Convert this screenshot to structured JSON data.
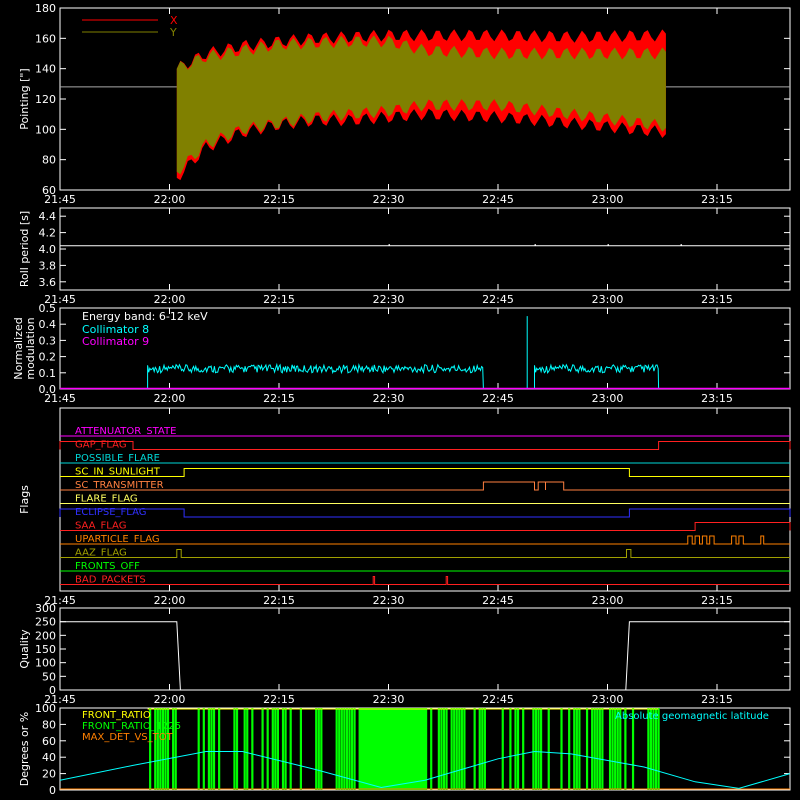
{
  "chart_data": [
    {
      "type": "line",
      "panel": "pointing",
      "ylabel": "Pointing [\"]",
      "xlim": [
        "21:45",
        "23:25"
      ],
      "ylim": [
        60,
        180
      ],
      "yticks": [
        60,
        80,
        100,
        120,
        140,
        160,
        180
      ],
      "xticks": [
        "21:45",
        "22:00",
        "22:15",
        "22:30",
        "22:45",
        "23:00",
        "23:15"
      ],
      "reference_line": 128,
      "data_start": "22:01",
      "data_end": "23:08",
      "legend": [
        {
          "name": "X",
          "color": "#ff0000"
        },
        {
          "name": "Y",
          "color": "#808000"
        }
      ],
      "series": [
        {
          "name": "X",
          "color": "#ff0000",
          "upper": [
            [
              "22:01",
              140
            ],
            [
              "22:05",
              150
            ],
            [
              "22:10",
              155
            ],
            [
              "22:15",
              158
            ],
            [
              "22:20",
              160
            ],
            [
              "22:25",
              161
            ],
            [
              "22:30",
              162
            ],
            [
              "22:35",
              162
            ],
            [
              "22:45",
              162
            ],
            [
              "22:55",
              161
            ],
            [
              "23:08",
              162
            ]
          ],
          "lower": [
            [
              "22:01",
              68
            ],
            [
              "22:05",
              88
            ],
            [
              "22:10",
              98
            ],
            [
              "22:15",
              103
            ],
            [
              "22:20",
              106
            ],
            [
              "22:25",
              106
            ],
            [
              "22:30",
              108
            ],
            [
              "22:35",
              110
            ],
            [
              "22:45",
              108
            ],
            [
              "22:55",
              104
            ],
            [
              "23:08",
              98
            ]
          ]
        },
        {
          "name": "Y",
          "color": "#808000",
          "upper": [
            [
              "22:01",
              140
            ],
            [
              "22:05",
              148
            ],
            [
              "22:10",
              152
            ],
            [
              "22:15",
              156
            ],
            [
              "22:20",
              157
            ],
            [
              "22:25",
              158
            ],
            [
              "22:30",
              158
            ],
            [
              "22:35",
              152
            ],
            [
              "22:45",
              150
            ],
            [
              "22:55",
              150
            ],
            [
              "23:08",
              150
            ]
          ],
          "lower": [
            [
              "22:01",
              72
            ],
            [
              "22:05",
              90
            ],
            [
              "22:10",
              100
            ],
            [
              "22:15",
              104
            ],
            [
              "22:20",
              108
            ],
            [
              "22:25",
              110
            ],
            [
              "22:30",
              112
            ],
            [
              "22:35",
              116
            ],
            [
              "22:45",
              116
            ],
            [
              "22:55",
              110
            ],
            [
              "23:08",
              102
            ]
          ]
        }
      ]
    },
    {
      "type": "line",
      "panel": "roll",
      "ylabel": "Roll period [s]",
      "ylim": [
        3.5,
        4.5
      ],
      "yticks": [
        3.6,
        3.8,
        4.0,
        4.2,
        4.4
      ],
      "xticks": [
        "21:45",
        "22:00",
        "22:15",
        "22:30",
        "22:45",
        "23:00",
        "23:15"
      ],
      "series": [
        {
          "name": "Roll period",
          "color": "#ffffff",
          "value": 4.04
        }
      ]
    },
    {
      "type": "line",
      "panel": "modulation",
      "ylabel": [
        "Normalized",
        "modulation"
      ],
      "ylim": [
        0.0,
        0.5
      ],
      "yticks": [
        0.0,
        0.1,
        0.2,
        0.3,
        0.4,
        0.5
      ],
      "xticks": [
        "21:45",
        "22:00",
        "22:15",
        "22:30",
        "22:45",
        "23:00",
        "23:15"
      ],
      "legend_title": "Energy band: 6-12 keV",
      "series": [
        {
          "name": "Collimator 8",
          "color": "#00ffff",
          "segments": [
            [
              "21:57",
              "22:43"
            ],
            [
              "22:50",
              "23:07"
            ]
          ],
          "level": 0.12,
          "spike": [
            "22:49",
            0.45
          ]
        },
        {
          "name": "Collimator 9",
          "color": "#ff00ff",
          "value": 0.0
        }
      ]
    },
    {
      "type": "line",
      "panel": "flags",
      "ylabel": "Flags",
      "xticks": [
        "21:45",
        "22:00",
        "22:15",
        "22:30",
        "22:45",
        "23:00",
        "23:15"
      ],
      "flags": [
        {
          "name": "ATTENUATOR_STATE",
          "color": "#ff00ff",
          "on": []
        },
        {
          "name": "GAP_FLAG",
          "color": "#ff2020",
          "on": [
            [
              "21:45",
              "21:55"
            ],
            [
              "23:07",
              "23:25"
            ]
          ]
        },
        {
          "name": "POSSIBLE_FLARE",
          "color": "#00d8d8",
          "on": []
        },
        {
          "name": "SC_IN_SUNLIGHT",
          "color": "#ffff00",
          "on": [
            [
              "22:02",
              "23:03"
            ]
          ]
        },
        {
          "name": "SC_TRANSMITTER",
          "color": "#ff8040",
          "on": [
            [
              "22:43",
              "22:50"
            ],
            [
              "22:50.5",
              "22:51.5"
            ],
            [
              "22:51.5",
              "22:54"
            ]
          ]
        },
        {
          "name": "FLARE_FLAG",
          "color": "#ffff60",
          "on": []
        },
        {
          "name": "ECLIPSE_FLAG",
          "color": "#3030ff",
          "on": [
            [
              "21:45",
              "22:02"
            ],
            [
              "23:03",
              "23:25"
            ]
          ]
        },
        {
          "name": "SAA_FLAG",
          "color": "#ff2020",
          "on": [
            [
              "23:12",
              "23:25"
            ]
          ]
        },
        {
          "name": "UPARTICLE_FLAG",
          "color": "#ff8000",
          "on": [
            [
              "23:11",
              "23:11.6"
            ],
            [
              "23:12",
              "23:12.6"
            ],
            [
              "23:13",
              "23:13.6"
            ],
            [
              "23:14",
              "23:14.6"
            ],
            [
              "23:17",
              "23:17.6"
            ],
            [
              "23:18",
              "23:18.6"
            ],
            [
              "23:21",
              "23:21.4"
            ]
          ]
        },
        {
          "name": "AAZ_FLAG",
          "color": "#a0a000",
          "on": [
            [
              "22:01",
              "22:01.6"
            ],
            [
              "23:02.6",
              "23:03.2"
            ]
          ]
        },
        {
          "name": "FRONTS_OFF",
          "color": "#00ff00",
          "on": []
        },
        {
          "name": "BAD_PACKETS",
          "color": "#ff2020",
          "on": [
            [
              "22:27.9",
              "22:28.1"
            ],
            [
              "22:37.9",
              "22:38.1"
            ]
          ]
        }
      ]
    },
    {
      "type": "line",
      "panel": "quality",
      "ylabel": "Quality",
      "ylim": [
        0,
        300
      ],
      "yticks": [
        0,
        50,
        100,
        150,
        200,
        250,
        300
      ],
      "xticks": [
        "21:45",
        "22:00",
        "22:15",
        "22:30",
        "22:45",
        "23:00",
        "23:15"
      ],
      "series": [
        {
          "name": "Quality",
          "color": "#ffffff",
          "points": [
            [
              "21:45",
              250
            ],
            [
              "22:01",
              250
            ],
            [
              "22:01.5",
              0
            ],
            [
              "23:02.5",
              0
            ],
            [
              "23:03",
              250
            ],
            [
              "23:25",
              250
            ]
          ]
        }
      ]
    },
    {
      "type": "area",
      "panel": "ratios",
      "ylabel": "Degrees or %",
      "ylim": [
        0,
        100
      ],
      "yticks": [
        0,
        20,
        40,
        60,
        80,
        100
      ],
      "legend": [
        {
          "name": "FRONT_RATIO",
          "color": "#ffff00"
        },
        {
          "name": "FRONT_RATIO_1225",
          "color": "#00ff00"
        },
        {
          "name": "MAX_DET_VS_TOT",
          "color": "#ff8000"
        }
      ],
      "legend_right": "Absolute geomagnetic latitude",
      "series": [
        {
          "name": "FRONT_RATIO_1225",
          "color": "#00ff00",
          "span": [
            "21:57",
            "23:07"
          ],
          "value": 100
        },
        {
          "name": "Absolute geomagnetic latitude",
          "color": "#00ffff",
          "points": [
            [
              "21:45",
              12
            ],
            [
              "21:55",
              30
            ],
            [
              "22:05",
              47
            ],
            [
              "22:10",
              47
            ],
            [
              "22:20",
              25
            ],
            [
              "22:29",
              3
            ],
            [
              "22:35",
              12
            ],
            [
              "22:45",
              38
            ],
            [
              "22:50",
              47
            ],
            [
              "22:55",
              44
            ],
            [
              "23:05",
              28
            ],
            [
              "23:12",
              10
            ],
            [
              "23:18",
              2
            ],
            [
              "23:25",
              20
            ]
          ]
        }
      ]
    }
  ]
}
